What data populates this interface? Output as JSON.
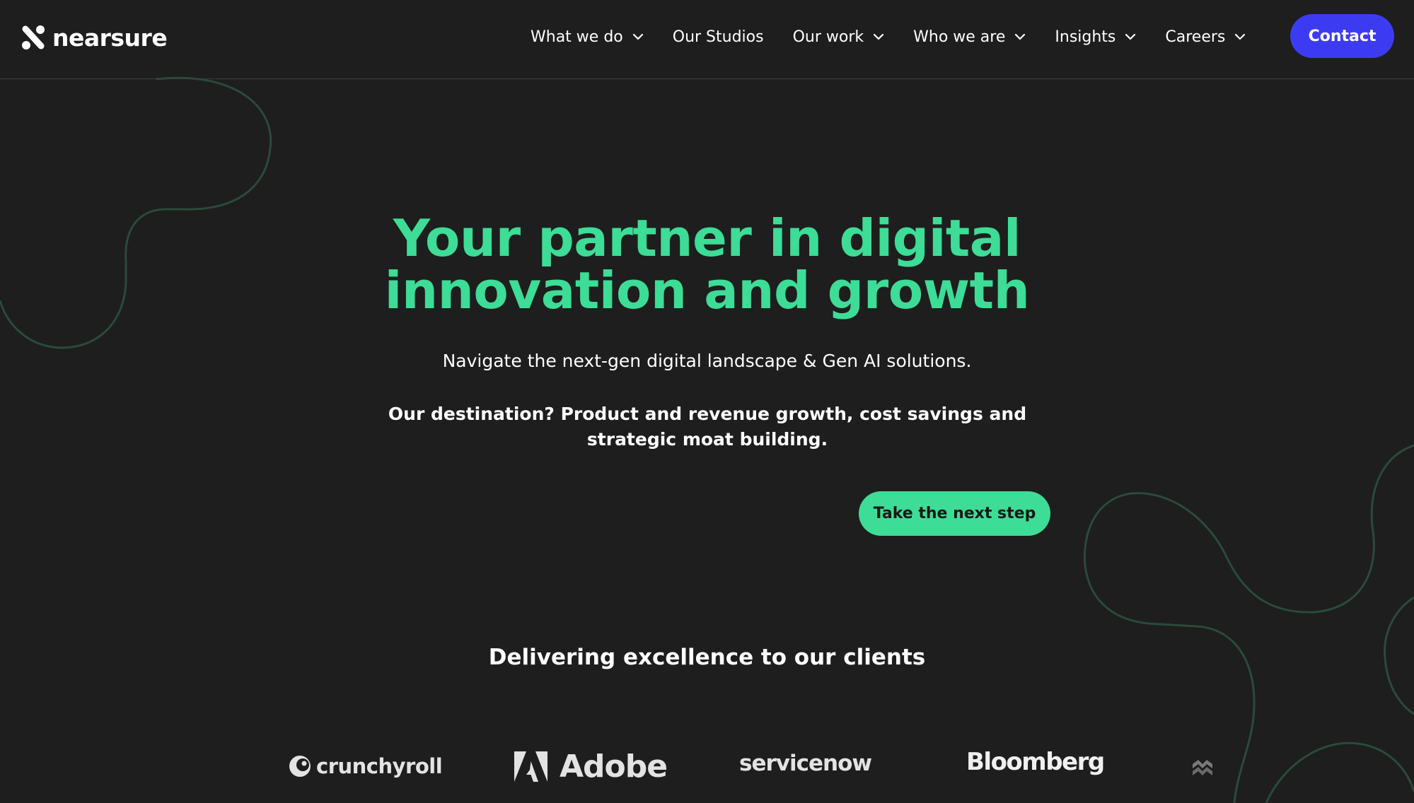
{
  "brand": {
    "name": "nearsure"
  },
  "nav": {
    "items": [
      {
        "label": "What we do",
        "has_dropdown": true
      },
      {
        "label": "Our Studios",
        "has_dropdown": false
      },
      {
        "label": "Our work",
        "has_dropdown": true
      },
      {
        "label": "Who we are",
        "has_dropdown": true
      },
      {
        "label": "Insights",
        "has_dropdown": true
      },
      {
        "label": "Careers",
        "has_dropdown": true
      }
    ],
    "contact_label": "Contact"
  },
  "hero": {
    "title_line1": "Your partner in digital",
    "title_line2": "innovation and growth",
    "subtitle": "Navigate the next-gen digital landscape & Gen AI solutions.",
    "destination": "Our destination? Product and revenue growth, cost savings and strategic moat building.",
    "cta_label": "Take the next step"
  },
  "clients": {
    "title": "Delivering excellence to our clients",
    "logos": [
      {
        "name": "crunchyroll",
        "icon": "crunchyroll-logo-icon"
      },
      {
        "name": "Adobe",
        "icon": "adobe-logo-icon"
      },
      {
        "name": "servicenow",
        "icon": "servicenow-logo-icon"
      },
      {
        "name": "Bloomberg",
        "icon": "bloomberg-logo-icon"
      },
      {
        "name": "",
        "icon": "partial-client-logo-icon"
      }
    ]
  },
  "colors": {
    "background": "#1d1e1d",
    "accent_green": "#3ddc97",
    "contact_blue": "#3d3bf2",
    "decor_line": "#2b4a3b"
  }
}
